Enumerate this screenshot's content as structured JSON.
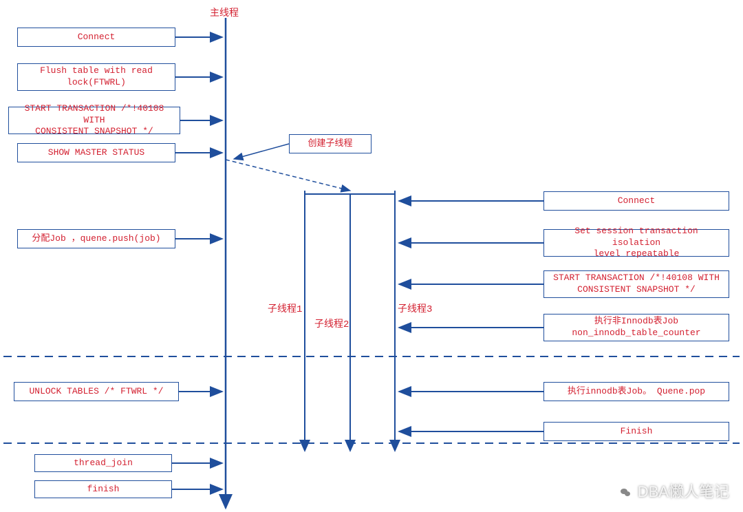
{
  "main_thread_label": "主线程",
  "left_boxes": {
    "connect": "Connect",
    "flush_table": "Flush table with read\nlock(FTWRL)",
    "start_tx": "START TRANSACTION /*!40108 WITH\nCONSISTENT SNAPSHOT */",
    "show_master": "SHOW MASTER STATUS",
    "alloc_job": "分配Job ，quene.push(job)",
    "unlock": "UNLOCK TABLES /* FTWRL */",
    "thread_join": "thread_join",
    "finish": "finish"
  },
  "middle_label": "创建子线程",
  "subthread_labels": {
    "t1": "子线程1",
    "t2": "子线程2",
    "t3": "子线程3"
  },
  "right_boxes": {
    "connect": "Connect",
    "set_session": "Set session transaction isolation\nlevel repeatable",
    "start_tx": "START TRANSACTION /*!40108 WITH\nCONSISTENT SNAPSHOT */",
    "non_innodb": "执行非Innodb表Job\nnon_innodb_table_counter",
    "innodb": "执行innodb表Job。 Quene.pop",
    "finish2": "Finish"
  },
  "watermark": "DBA懒人笔记"
}
